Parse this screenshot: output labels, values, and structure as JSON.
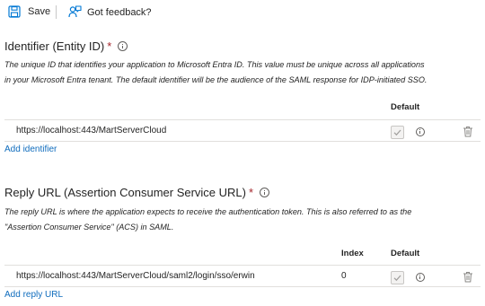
{
  "toolbar": {
    "save_label": "Save",
    "feedback_label": "Got feedback?"
  },
  "identifier": {
    "title": "Identifier (Entity ID)",
    "required_mark": "*",
    "description_line1": "The unique ID that identifies your application to Microsoft Entra ID. This value must be unique across all applications",
    "description_line2": "in your Microsoft Entra tenant. The default identifier will be the audience of the SAML response for IDP-initiated SSO.",
    "default_header": "Default",
    "rows": [
      {
        "url": "https://localhost:443/MartServerCloud"
      }
    ],
    "add_link": "Add identifier"
  },
  "reply": {
    "title": "Reply URL (Assertion Consumer Service URL)",
    "required_mark": "*",
    "description_line1": "The reply URL is where the application expects to receive the authentication token. This is also referred to as the",
    "description_line2": "\"Assertion Consumer Service\" (ACS) in SAML.",
    "index_header": "Index",
    "default_header": "Default",
    "rows": [
      {
        "url": "https://localhost:443/MartServerCloud/saml2/login/sso/erwin",
        "index": "0"
      }
    ],
    "add_link": "Add reply URL"
  },
  "icons": {
    "save": "save-icon",
    "feedback": "feedback-person-icon",
    "info": "info-icon",
    "delete": "trash-icon",
    "checkbox": "checkmark-icon"
  },
  "colors": {
    "link": "#0f6cbd",
    "required": "#a4262c",
    "accent": "#0078d4"
  }
}
